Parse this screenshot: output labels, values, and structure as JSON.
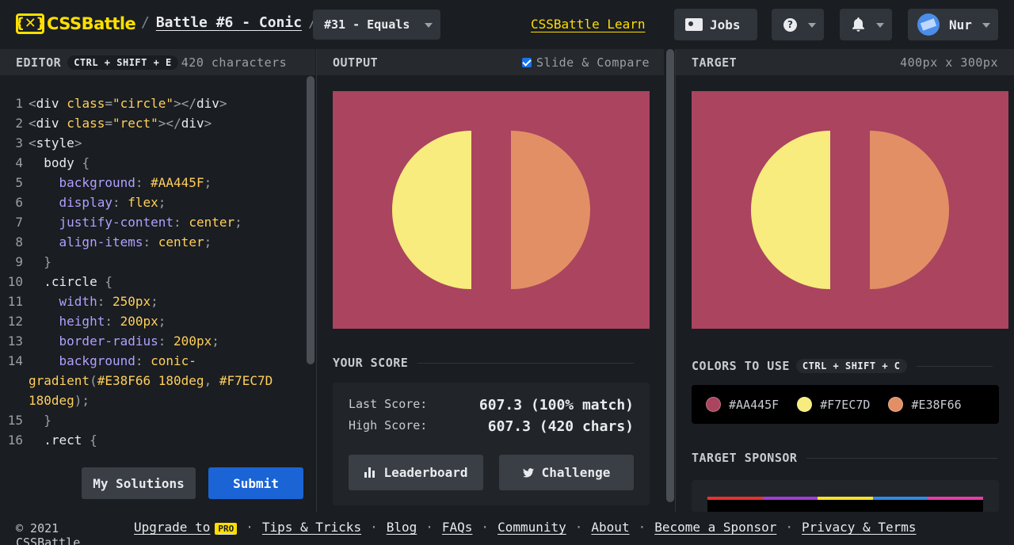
{
  "header": {
    "logo_text": "CSSBattle",
    "logo_mark": "{✕}",
    "breadcrumb": [
      "Battle #6 - Conic"
    ],
    "target_select": "#31 - Equals",
    "learn_link": "CSSBattle Learn",
    "jobs_label": "Jobs",
    "help_glyph": "?",
    "user_name": "Nur"
  },
  "editor": {
    "title": "EDITOR",
    "shortcut": "CTRL + SHIFT + E",
    "char_count": "420 characters",
    "my_solutions_label": "My Solutions",
    "submit_label": "Submit",
    "lines": [
      {
        "n": "1"
      },
      {
        "n": "2"
      },
      {
        "n": "3"
      },
      {
        "n": "4"
      },
      {
        "n": "5"
      },
      {
        "n": "6"
      },
      {
        "n": "7"
      },
      {
        "n": "8"
      },
      {
        "n": "9"
      },
      {
        "n": "10"
      },
      {
        "n": "11"
      },
      {
        "n": "12"
      },
      {
        "n": "13"
      },
      {
        "n": "14"
      },
      {
        "n": ""
      },
      {
        "n": ""
      },
      {
        "n": "15"
      },
      {
        "n": "16"
      }
    ],
    "code": {
      "l1_tag": "div",
      "l1_attr": "class",
      "l1_val": "\"circle\"",
      "l2_tag": "div",
      "l2_attr": "class",
      "l2_val": "\"rect\"",
      "l3_tag": "style",
      "l4_sel": "body",
      "l5_prop": "background",
      "l5_val": "#AA445F",
      "l6_prop": "display",
      "l6_val": "flex",
      "l7_prop": "justify-content",
      "l7_val": "center",
      "l8_prop": "align-items",
      "l8_val": "center",
      "l10_sel": ".circle",
      "l11_prop": "width",
      "l11_val": "250px",
      "l12_prop": "height",
      "l12_val": "200px",
      "l13_prop": "border-radius",
      "l13_val": "200px",
      "l14_prop": "background",
      "l14_val": "conic-",
      "l14b_fn": "gradient",
      "l14b_c1": "#E38F66 180deg",
      "l14b_c2": "#F7EC7D",
      "l14c_val": "180deg",
      "l16_sel": ".rect"
    }
  },
  "output": {
    "title": "OUTPUT",
    "compare_label": "Slide & Compare"
  },
  "target": {
    "title": "TARGET",
    "dims": "400px x 300px"
  },
  "score": {
    "title": "YOUR SCORE",
    "last_label": "Last Score:",
    "last_value": "607.3 (100% match)",
    "high_label": "High Score:",
    "high_value": "607.3 (420 chars)",
    "leaderboard_label": "Leaderboard",
    "challenge_label": "Challenge"
  },
  "colors": {
    "title": "COLORS TO USE",
    "shortcut": "CTRL + SHIFT + C",
    "items": [
      "#AA445F",
      "#F7EC7D",
      "#E38F66"
    ]
  },
  "sponsor": {
    "title": "TARGET SPONSOR"
  },
  "footer": {
    "copyright": "© 2021 CSSBattle",
    "upgrade": "Upgrade to",
    "pro_badge": "PRO",
    "links": [
      "Tips & Tricks",
      "Blog",
      "FAQs",
      "Community",
      "About",
      "Become a Sponsor",
      "Privacy & Terms"
    ]
  },
  "palette": {
    "bg": "#AA445F",
    "yellow": "#F7EC7D",
    "orange": "#E38F66",
    "accent": "#FFDF00",
    "submit": "#1A64D6"
  }
}
